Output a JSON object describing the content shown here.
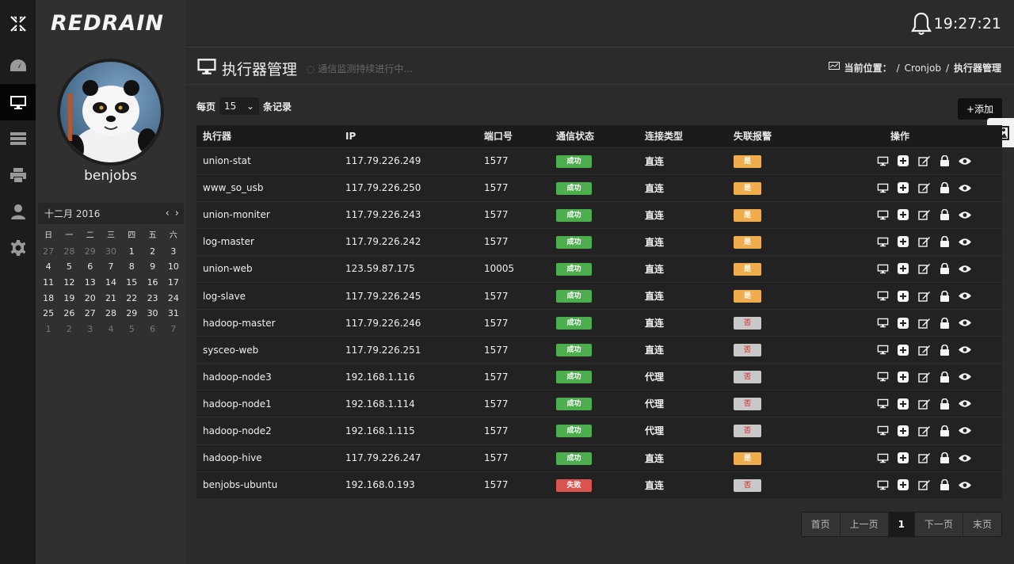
{
  "brand": "REDRAIN",
  "user": {
    "name": "benjobs"
  },
  "calendar": {
    "title": "十二月 2016",
    "weekdays": [
      "日",
      "一",
      "二",
      "三",
      "四",
      "五",
      "六"
    ],
    "days": [
      {
        "d": "27",
        "m": true
      },
      {
        "d": "28",
        "m": true
      },
      {
        "d": "29",
        "m": true
      },
      {
        "d": "30",
        "m": true
      },
      {
        "d": "1"
      },
      {
        "d": "2"
      },
      {
        "d": "3"
      },
      {
        "d": "4"
      },
      {
        "d": "5"
      },
      {
        "d": "6"
      },
      {
        "d": "7"
      },
      {
        "d": "8"
      },
      {
        "d": "9"
      },
      {
        "d": "10"
      },
      {
        "d": "11"
      },
      {
        "d": "12"
      },
      {
        "d": "13"
      },
      {
        "d": "14"
      },
      {
        "d": "15"
      },
      {
        "d": "16"
      },
      {
        "d": "17"
      },
      {
        "d": "18"
      },
      {
        "d": "19"
      },
      {
        "d": "20"
      },
      {
        "d": "21"
      },
      {
        "d": "22"
      },
      {
        "d": "23"
      },
      {
        "d": "24"
      },
      {
        "d": "25"
      },
      {
        "d": "26"
      },
      {
        "d": "27"
      },
      {
        "d": "28"
      },
      {
        "d": "29"
      },
      {
        "d": "30"
      },
      {
        "d": "31"
      },
      {
        "d": "1",
        "m": true
      },
      {
        "d": "2",
        "m": true
      },
      {
        "d": "3",
        "m": true
      },
      {
        "d": "4",
        "m": true
      },
      {
        "d": "5",
        "m": true
      },
      {
        "d": "6",
        "m": true
      },
      {
        "d": "7",
        "m": true
      }
    ]
  },
  "topbar": {
    "clock": "19:27:21"
  },
  "page": {
    "title": "执行器管理",
    "status": "通信监测持续进行中...",
    "breadcrumb": {
      "label": "当前位置：",
      "sep1": "/",
      "item1": "Cronjob",
      "sep2": "/",
      "item2": "执行器管理"
    }
  },
  "toolbar": {
    "per_page_prefix": "每页",
    "per_page_value": "15",
    "per_page_suffix": "条记录",
    "add_label": "+添加"
  },
  "table": {
    "headers": [
      "执行器",
      "IP",
      "端口号",
      "通信状态",
      "连接类型",
      "失联报警",
      "操作"
    ],
    "rows": [
      {
        "name": "union-stat",
        "ip": "117.79.226.249",
        "port": "1577",
        "status": "成功",
        "ok": true,
        "conn": "直连",
        "alarm": "是",
        "alarm_on": true
      },
      {
        "name": "www_so_usb",
        "ip": "117.79.226.250",
        "port": "1577",
        "status": "成功",
        "ok": true,
        "conn": "直连",
        "alarm": "是",
        "alarm_on": true
      },
      {
        "name": "union-moniter",
        "ip": "117.79.226.243",
        "port": "1577",
        "status": "成功",
        "ok": true,
        "conn": "直连",
        "alarm": "是",
        "alarm_on": true
      },
      {
        "name": "log-master",
        "ip": "117.79.226.242",
        "port": "1577",
        "status": "成功",
        "ok": true,
        "conn": "直连",
        "alarm": "是",
        "alarm_on": true
      },
      {
        "name": "union-web",
        "ip": "123.59.87.175",
        "port": "10005",
        "status": "成功",
        "ok": true,
        "conn": "直连",
        "alarm": "是",
        "alarm_on": true
      },
      {
        "name": "log-slave",
        "ip": "117.79.226.245",
        "port": "1577",
        "status": "成功",
        "ok": true,
        "conn": "直连",
        "alarm": "是",
        "alarm_on": true
      },
      {
        "name": "hadoop-master",
        "ip": "117.79.226.246",
        "port": "1577",
        "status": "成功",
        "ok": true,
        "conn": "直连",
        "alarm": "否",
        "alarm_on": false
      },
      {
        "name": "sysceo-web",
        "ip": "117.79.226.251",
        "port": "1577",
        "status": "成功",
        "ok": true,
        "conn": "直连",
        "alarm": "否",
        "alarm_on": false
      },
      {
        "name": "hadoop-node3",
        "ip": "192.168.1.116",
        "port": "1577",
        "status": "成功",
        "ok": true,
        "conn": "代理",
        "alarm": "否",
        "alarm_on": false
      },
      {
        "name": "hadoop-node1",
        "ip": "192.168.1.114",
        "port": "1577",
        "status": "成功",
        "ok": true,
        "conn": "代理",
        "alarm": "否",
        "alarm_on": false
      },
      {
        "name": "hadoop-node2",
        "ip": "192.168.1.115",
        "port": "1577",
        "status": "成功",
        "ok": true,
        "conn": "代理",
        "alarm": "否",
        "alarm_on": false
      },
      {
        "name": "hadoop-hive",
        "ip": "117.79.226.247",
        "port": "1577",
        "status": "成功",
        "ok": true,
        "conn": "直连",
        "alarm": "是",
        "alarm_on": true
      },
      {
        "name": "benjobs-ubuntu",
        "ip": "192.168.0.193",
        "port": "1577",
        "status": "失败",
        "ok": false,
        "conn": "直连",
        "alarm": "否",
        "alarm_on": false
      }
    ]
  },
  "pager": {
    "first": "首页",
    "prev": "上一页",
    "current": "1",
    "next": "下一页",
    "last": "末页"
  },
  "colors": {
    "success": "#4cae4c",
    "fail": "#d9534f",
    "alarm_yes": "#f0ad4e",
    "alarm_no": "#c8c8c8"
  }
}
